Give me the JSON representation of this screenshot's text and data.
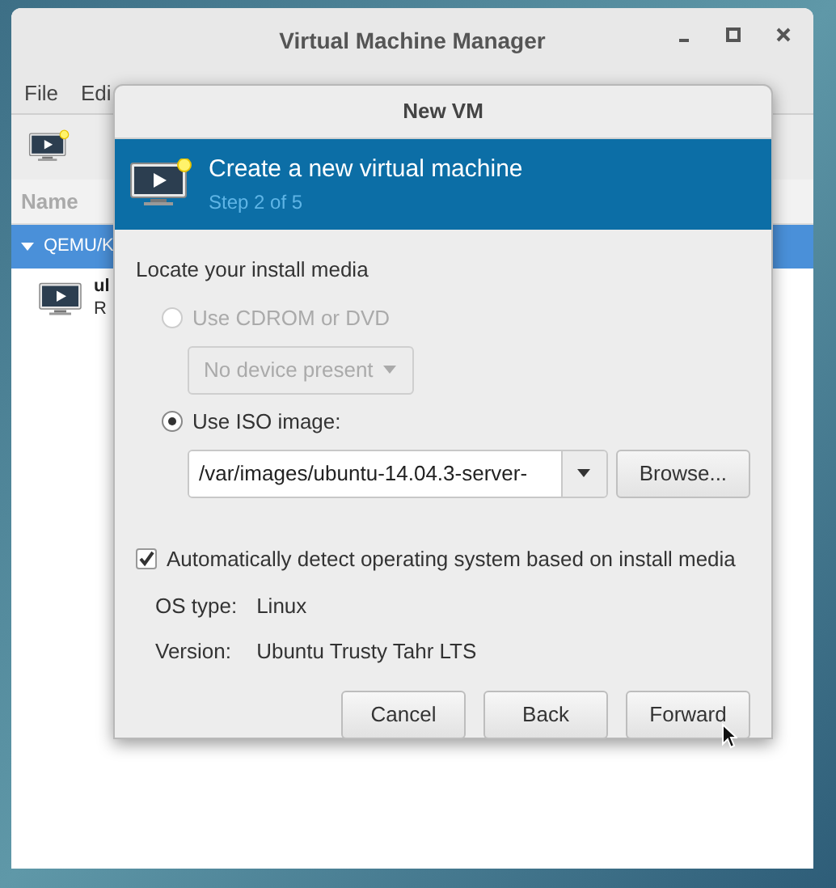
{
  "main_window": {
    "title": "Virtual Machine Manager",
    "menu": [
      "File",
      "Edi"
    ],
    "column_header": "Name",
    "connection": {
      "label": "QEMU/K",
      "expanded": true
    },
    "vm": {
      "name": "ul",
      "status": "R"
    }
  },
  "dialog": {
    "title": "New VM",
    "header": {
      "title": "Create a new virtual machine",
      "step": "Step 2 of 5"
    },
    "section_label": "Locate your install media",
    "options": [
      {
        "kind": "cdrom",
        "label": "Use CDROM or DVD",
        "selected": false,
        "disabled": true,
        "dropdown": "No device present"
      },
      {
        "kind": "iso",
        "label": "Use ISO image:",
        "selected": true,
        "disabled": false,
        "path": "/var/images/ubuntu-14.04.3-server-",
        "browse": "Browse..."
      }
    ],
    "auto_detect": {
      "label": "Automatically detect operating system based on install media",
      "checked": true
    },
    "os_info": [
      {
        "label": "OS type:",
        "value": "Linux"
      },
      {
        "label": "Version:",
        "value": "Ubuntu Trusty Tahr LTS"
      }
    ],
    "buttons": [
      "Cancel",
      "Back",
      "Forward"
    ]
  }
}
